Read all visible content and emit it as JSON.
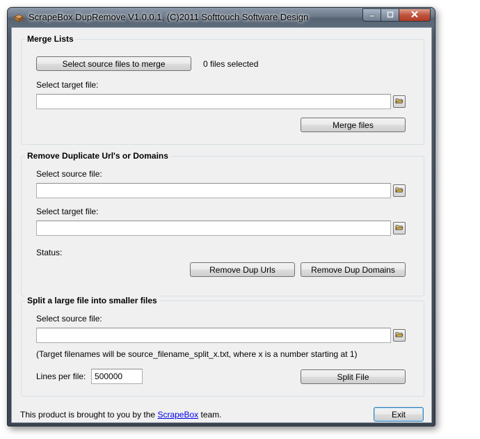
{
  "window": {
    "title": "ScrapeBox DupRemove V1.0.0.1, (C)2011 Softtouch Software Design"
  },
  "merge": {
    "group_title": "Merge Lists",
    "select_button": "Select source files to merge",
    "files_selected": "0 files selected",
    "target_label": "Select target file:",
    "target_value": "",
    "merge_button": "Merge files"
  },
  "dup": {
    "group_title": "Remove Duplicate Url's or Domains",
    "source_label": "Select source file:",
    "source_value": "",
    "target_label": "Select target file:",
    "target_value": "",
    "status_label": "Status:",
    "remove_urls_button": "Remove Dup Urls",
    "remove_domains_button": "Remove Dup Domains"
  },
  "split": {
    "group_title": "Split a large file into smaller files",
    "source_label": "Select source file:",
    "source_value": "",
    "note": "(Target filenames will be source_filename_split_x.txt, where x is a number starting at 1)",
    "lines_label": "Lines per file:",
    "lines_value": "500000",
    "split_button": "Split File"
  },
  "footer": {
    "text_before": "This product is brought to you by the ",
    "link_text": "ScrapeBox",
    "text_after": " team.",
    "exit_button": "Exit"
  },
  "icons": [
    "app-icon",
    "minimize-icon",
    "maximize-icon",
    "close-icon",
    "folder-open-icon"
  ]
}
